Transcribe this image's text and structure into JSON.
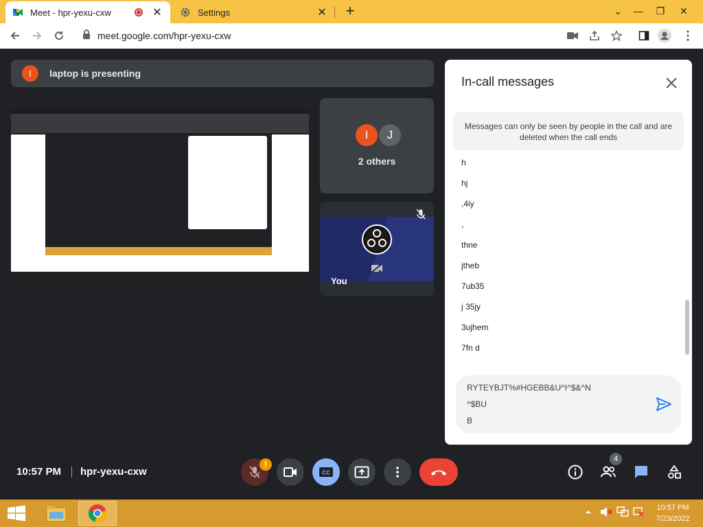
{
  "browser": {
    "tabs": [
      {
        "title": "Meet - hpr-yexu-cxw",
        "active": true
      },
      {
        "title": "Settings",
        "active": false
      }
    ],
    "url": "meet.google.com/hpr-yexu-cxw",
    "new_tab_label": "+"
  },
  "meet": {
    "presenting_text": "laptop is presenting",
    "presenter_initial": "l",
    "others_label": "2 others",
    "others_initials": [
      "I",
      "J"
    ],
    "you_label": "You",
    "time": "10:57 PM",
    "meeting_code": "hpr-yexu-cxw",
    "people_count": "4",
    "mic_warning": "!",
    "cc_label": "CC"
  },
  "chat": {
    "title": "In-call messages",
    "notice": "Messages can only be seen by people in the call and are deleted when the call ends",
    "messages": [
      "h",
      "hj",
      ",4iy",
      ",",
      "thne",
      "jtheb",
      "7ub35",
      "j 35jy",
      "3ujhem",
      "7fn d"
    ],
    "composer_lines": [
      "RYTEYBJT%#HGEBB&U^I^$&^N",
      "^$BU",
      "B"
    ]
  },
  "taskbar": {
    "time": "10:57 PM",
    "date": "7/23/2022"
  },
  "colors": {
    "accent_yellow": "#f6c344",
    "meet_bg": "#202124",
    "hangup_red": "#ea4335",
    "cc_blue": "#8ab4f8",
    "taskbar": "#d79a2e"
  }
}
